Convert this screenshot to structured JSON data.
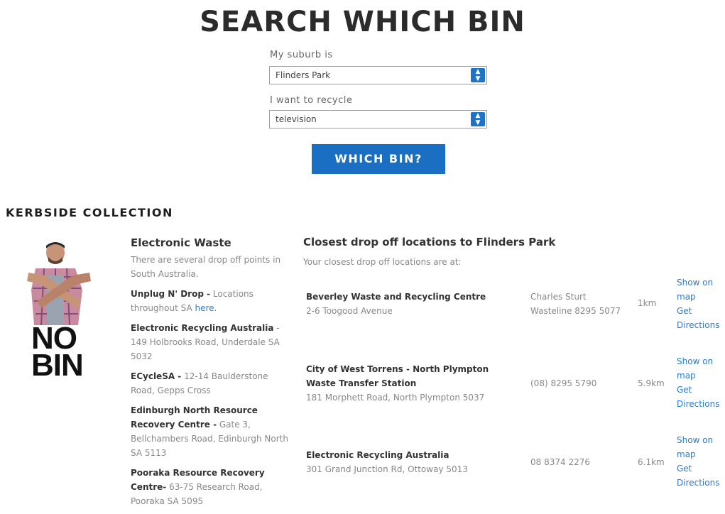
{
  "page_title": "SEARCH WHICH BIN",
  "form": {
    "suburb_label": "My suburb is",
    "suburb_value": "Flinders Park",
    "recycle_label": "I want to recycle",
    "recycle_value": "television",
    "submit_label": "WHICH BIN?"
  },
  "kerbside": {
    "heading": "KERBSIDE COLLECTION",
    "sign_line1": "NO",
    "sign_line2": "BIN"
  },
  "electronic_waste": {
    "heading": "Electronic Waste",
    "intro": "There are several drop off points in South Australia.",
    "items": [
      {
        "name": "Unplug N' Drop -",
        "detail": " Locations throughout SA ",
        "link": "here."
      },
      {
        "name": "Electronic Recycling Australia",
        "detail": " - 149 Holbrooks Road, Underdale SA 5032"
      },
      {
        "name": "ECycleSA -",
        "detail": " 12-14 Baulderstone Road, Gepps Cross"
      },
      {
        "name": "Edinburgh North Resource Recovery Centre -",
        "detail": " Gate 3, Bellchambers Road, Edinburgh North SA 5113"
      },
      {
        "name": "Pooraka Resource Recovery Centre-",
        "detail": " 63-75 Research Road, Pooraka SA 5095"
      }
    ]
  },
  "drop_off": {
    "heading": "Closest drop off locations to Flinders Park",
    "subheading": "Your closest drop off locations are at:",
    "locations": [
      {
        "name_line1": "Beverley Waste and Recycling Centre",
        "name_line2": "",
        "address": "2-6 Toogood Avenue",
        "phone_line1": "Charles Sturt",
        "phone_line2": "Wasteline 8295 5077",
        "distance": "1km",
        "map_line1": "Show on",
        "map_line2": "map",
        "dir_line1": "Get",
        "dir_line2": "Directions"
      },
      {
        "name_line1": "City of West Torrens - North Plympton",
        "name_line2": "Waste Transfer Station",
        "address": "181 Morphett Road, North Plympton 5037",
        "phone_line1": "(08) 8295 5790",
        "phone_line2": "",
        "distance": "5.9km",
        "map_line1": "Show on",
        "map_line2": "map",
        "dir_line1": "Get",
        "dir_line2": "Directions"
      },
      {
        "name_line1": "Electronic Recycling Australia",
        "name_line2": "",
        "address": "301 Grand Junction Rd, Ottoway 5013",
        "phone_line1": "08 8374 2276",
        "phone_line2": "",
        "distance": "6.1km",
        "map_line1": "Show on",
        "map_line2": "map",
        "dir_line1": "Get",
        "dir_line2": "Directions"
      }
    ]
  },
  "colors": {
    "accent": "#1a6fc3",
    "link": "#2a7bd1"
  }
}
